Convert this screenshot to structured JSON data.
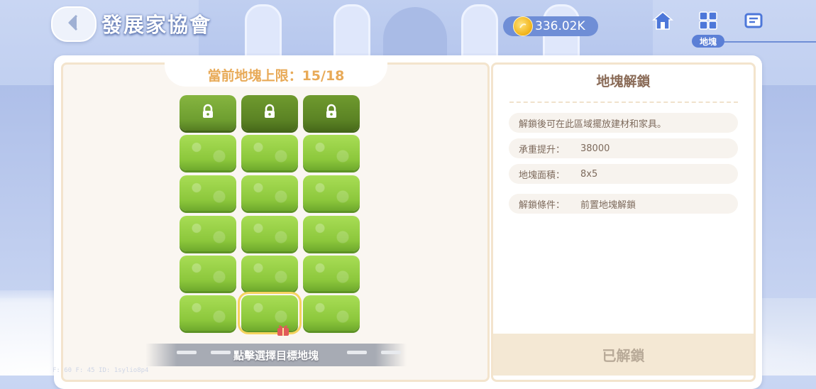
{
  "header": {
    "title": "發展家協會",
    "coins": "336.02K",
    "active_nav_label": "地塊"
  },
  "icons": {
    "back": "chevron-left-icon",
    "coin": "coin-icon",
    "home": "home-icon",
    "plots": "grid-icon",
    "tasks": "clipboard-icon",
    "lock": "lock-icon",
    "gift": "gift-icon"
  },
  "grid": {
    "limit_label": "當前地塊上限：15/18",
    "plots": [
      {
        "state": "locked"
      },
      {
        "state": "locked"
      },
      {
        "state": "locked"
      },
      {
        "state": "open"
      },
      {
        "state": "open"
      },
      {
        "state": "open"
      },
      {
        "state": "open"
      },
      {
        "state": "open"
      },
      {
        "state": "open"
      },
      {
        "state": "open"
      },
      {
        "state": "open"
      },
      {
        "state": "open"
      },
      {
        "state": "open"
      },
      {
        "state": "open"
      },
      {
        "state": "open"
      },
      {
        "state": "open"
      },
      {
        "state": "selected"
      },
      {
        "state": "open"
      }
    ],
    "hint": "點擊選擇目標地塊"
  },
  "info": {
    "title": "地塊解鎖",
    "description": "解鎖後可在此區域擺放建材和家具。",
    "rows": [
      {
        "label": "承重提升：",
        "value": "38000"
      },
      {
        "label": "地塊面積：",
        "value": "8x5"
      },
      {
        "label": "解鎖條件：",
        "value": "前置地塊解鎖"
      }
    ],
    "status_button": "已解鎖"
  },
  "debug": "F: 60   F: 45   ID: 1sylio8p4",
  "colors": {
    "accent_blue": "#5b7fd6",
    "limit_text": "#e8aa58",
    "info_text": "#8a6b57",
    "grass": "#8cc73c",
    "selected_outline": "#f4d35e"
  }
}
